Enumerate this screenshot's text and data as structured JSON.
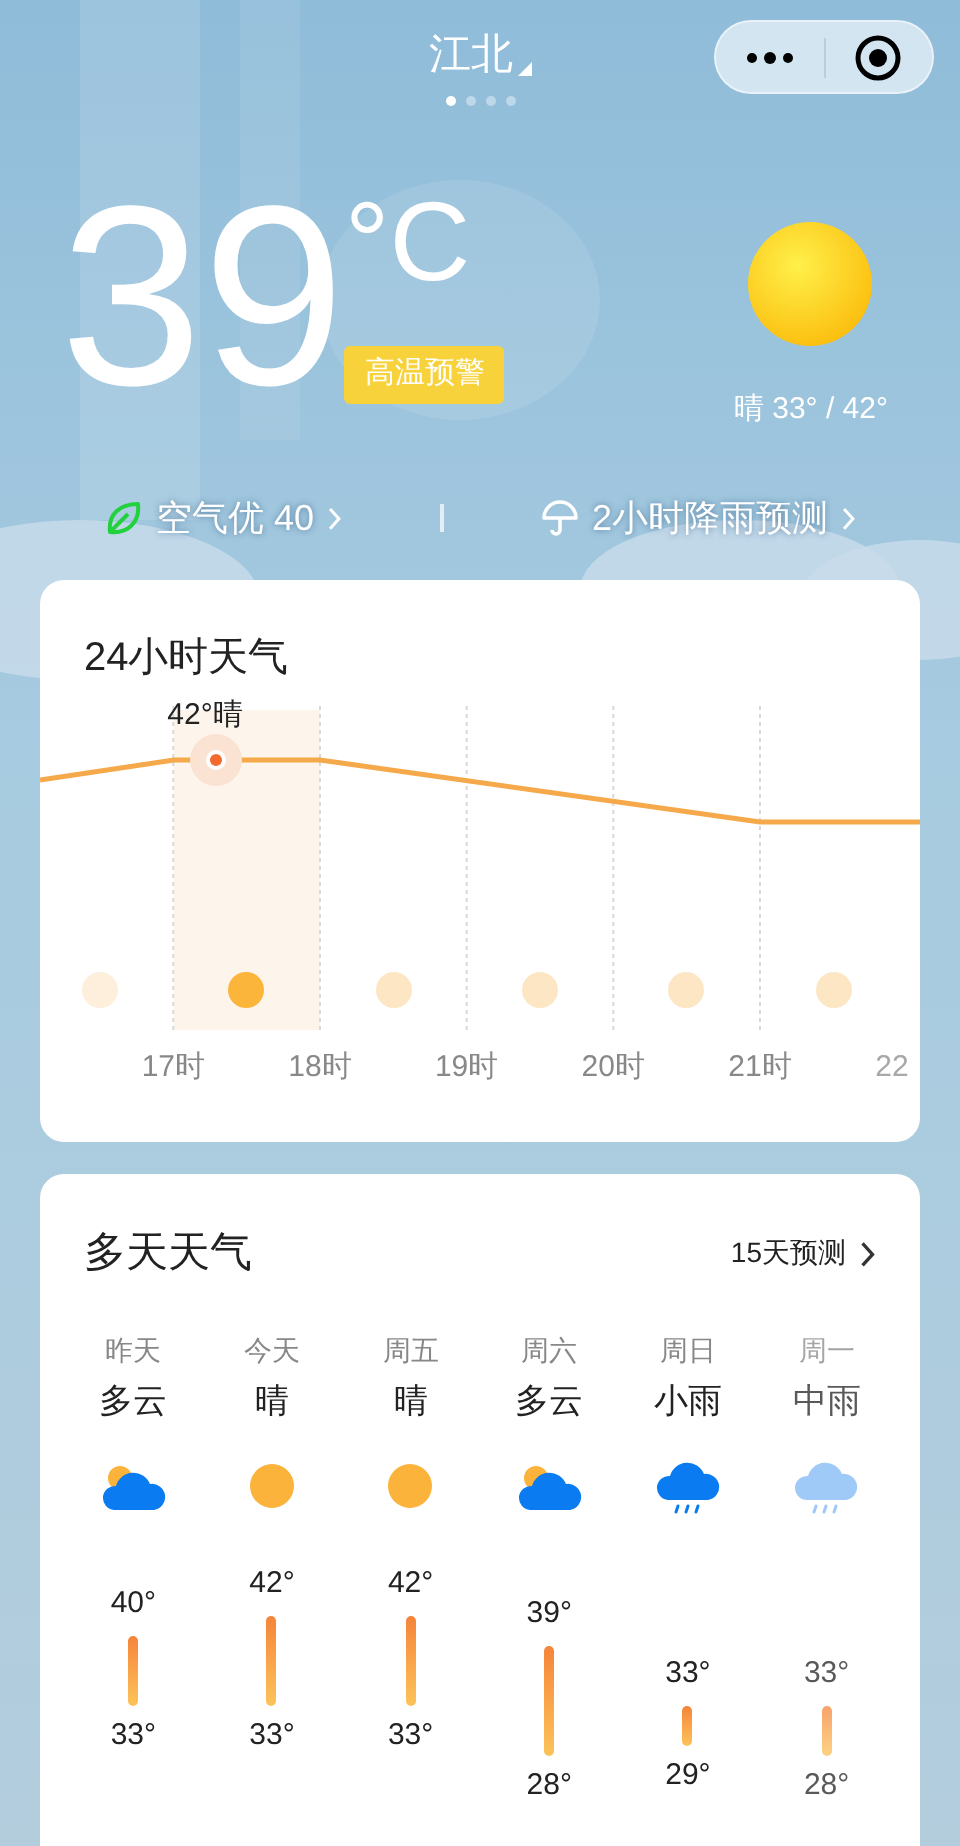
{
  "header": {
    "city": "江北",
    "pages": [
      {
        "selected": true
      },
      {
        "selected": false
      },
      {
        "selected": false
      },
      {
        "selected": false
      }
    ]
  },
  "current": {
    "temperature": "39",
    "unit": "°C",
    "alert": "高温预警",
    "condition": "晴 33° / 42°"
  },
  "links": [
    {
      "kind": "air",
      "label": "空气优 40"
    },
    {
      "kind": "rain",
      "label": "2小时降雨预测"
    }
  ],
  "hourly": {
    "title": "24小时天气",
    "slots": [
      {
        "selected": false
      },
      {
        "selected": true,
        "label": "42°晴"
      },
      {
        "selected": false
      },
      {
        "selected": false
      },
      {
        "selected": false
      },
      {
        "selected": false
      }
    ],
    "hours": [
      "17时",
      "18时",
      "19时",
      "20时",
      "21时",
      "22"
    ]
  },
  "daily": {
    "title": "多天天气",
    "more": "15天预测",
    "days": [
      {
        "day": "昨天",
        "condition": "多云",
        "kind": "cloudy",
        "high": "40°",
        "low": "33°"
      },
      {
        "day": "今天",
        "condition": "晴",
        "kind": "sunny",
        "high": "42°",
        "low": "33°"
      },
      {
        "day": "周五",
        "condition": "晴",
        "kind": "sunny",
        "high": "42°",
        "low": "33°"
      },
      {
        "day": "周六",
        "condition": "多云",
        "kind": "cloudy",
        "high": "39°",
        "low": "28°"
      },
      {
        "day": "周日",
        "condition": "小雨",
        "kind": "light-rain",
        "high": "33°",
        "low": "29°"
      },
      {
        "day": "周一",
        "condition": "中雨",
        "kind": "moderate-rain",
        "high": "33°",
        "low": "28°"
      }
    ]
  }
}
